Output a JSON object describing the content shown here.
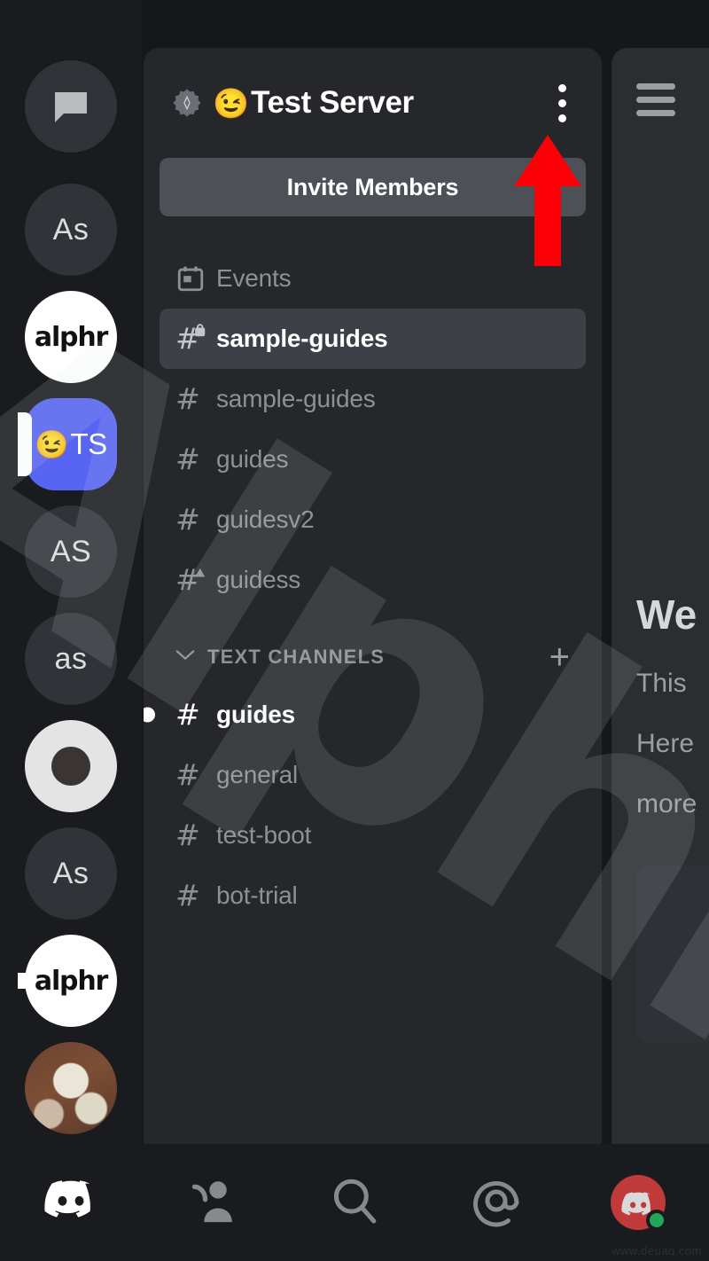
{
  "colors": {
    "app_bg": "#16171a",
    "rail_bg": "#1a1b1e",
    "channel_panel_bg": "#26272b",
    "chat_panel_bg": "#2b2d31",
    "invite_button_bg": "#4e5058",
    "selected_channel_bg": "#3d4046",
    "accent_blurple": "#5865f2",
    "arrow_red": "#fb0007",
    "muted_text": "#8d9196",
    "active_text": "#ffffff",
    "status_online": "#23a55a",
    "avatar_red": "#c03a3a"
  },
  "server_rail": {
    "items": [
      {
        "name": "direct-messages",
        "type": "dm",
        "icon": "speech-bubble-icon",
        "label": "",
        "state": "none"
      },
      {
        "name": "guild-as-1",
        "type": "initials",
        "icon": "",
        "label": "As",
        "state": "none"
      },
      {
        "name": "guild-alphr-1",
        "type": "wordmark",
        "icon": "",
        "label": "alphr",
        "state": "none"
      },
      {
        "name": "guild-test-server",
        "type": "emoji-initials",
        "icon": "",
        "label": "TS",
        "emoji": "😉",
        "state": "selected"
      },
      {
        "name": "guild-as-2",
        "type": "initials",
        "icon": "",
        "label": "AS",
        "state": "none"
      },
      {
        "name": "guild-as-3",
        "type": "initials",
        "icon": "",
        "label": "as",
        "state": "none"
      },
      {
        "name": "guild-ring",
        "type": "logo",
        "icon": "ring-logo-icon",
        "label": "",
        "state": "none"
      },
      {
        "name": "guild-as-4",
        "type": "initials",
        "icon": "",
        "label": "As",
        "state": "none"
      },
      {
        "name": "guild-alphr-2",
        "type": "wordmark",
        "icon": "",
        "label": "alphr",
        "state": "unread"
      },
      {
        "name": "guild-dog-photo",
        "type": "photo",
        "icon": "",
        "label": "",
        "state": "none"
      }
    ]
  },
  "server_header": {
    "boost_badge_icon": "server-boost-badge-icon",
    "emoji": "😉",
    "name": "Test Server",
    "more_icon": "three-dot-overflow-icon"
  },
  "invite": {
    "label": "Invite Members"
  },
  "events_row": {
    "icon": "calendar-icon",
    "label": "Events"
  },
  "channels_top": [
    {
      "label": "sample-guides",
      "icon": "hash-lock-icon",
      "state": "selected"
    },
    {
      "label": "sample-guides",
      "icon": "hash-icon",
      "state": "muted"
    },
    {
      "label": "guides",
      "icon": "hash-icon",
      "state": "muted"
    },
    {
      "label": "guidesv2",
      "icon": "hash-icon",
      "state": "muted"
    },
    {
      "label": "guidess",
      "icon": "hash-warning-icon",
      "state": "muted"
    }
  ],
  "category": {
    "chevron_icon": "chevron-down-icon",
    "label": "TEXT CHANNELS",
    "add_icon": "plus-icon"
  },
  "channels_text": [
    {
      "label": "guides",
      "icon": "hash-icon",
      "state": "unread"
    },
    {
      "label": "general",
      "icon": "hash-icon",
      "state": "muted"
    },
    {
      "label": "test-boot",
      "icon": "hash-icon",
      "state": "muted"
    },
    {
      "label": "bot-trial",
      "icon": "hash-icon",
      "state": "muted"
    }
  ],
  "chat_panel": {
    "menu_icon": "hamburger-menu-icon",
    "welcome_title": "We",
    "line_1": "This",
    "line_2": "Here",
    "line_3": "more"
  },
  "bottom_nav": [
    {
      "name": "nav-home",
      "icon": "discord-logo-icon",
      "label": ""
    },
    {
      "name": "nav-friends",
      "icon": "friends-icon",
      "label": ""
    },
    {
      "name": "nav-search",
      "icon": "search-icon",
      "label": ""
    },
    {
      "name": "nav-mentions",
      "icon": "at-mention-icon",
      "label": ""
    },
    {
      "name": "nav-profile",
      "icon": "avatar-icon",
      "label": ""
    }
  ],
  "annotation": {
    "arrow_icon": "red-up-arrow-icon",
    "points_to": "three-dot-overflow-icon"
  },
  "watermark": {
    "text": "Alphr",
    "site_mark": "www.deuaq.com"
  }
}
